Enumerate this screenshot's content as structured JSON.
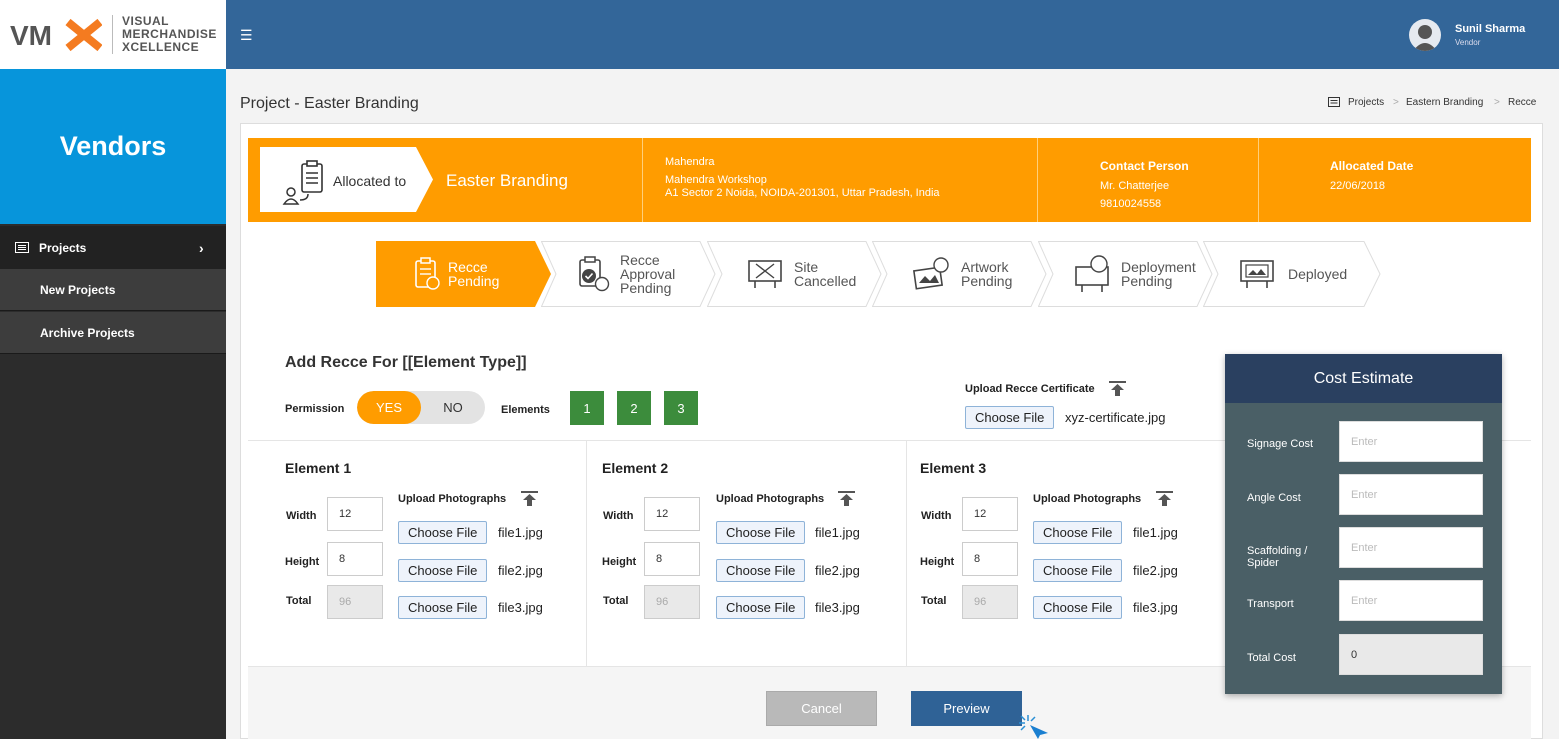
{
  "brand": {
    "logo": "VMX",
    "line1": "VISUAL",
    "line2": "MERCHANDISE",
    "line3": "XCELLENCE"
  },
  "sidebar": {
    "section_title": "Vendors",
    "items": [
      {
        "label": "Projects"
      },
      {
        "label": "New Projects"
      },
      {
        "label": "Archive Projects"
      }
    ]
  },
  "user": {
    "name": "Sunil Sharma",
    "role": "Vendor"
  },
  "page": {
    "title": "Project - Easter Branding"
  },
  "breadcrumb": [
    "Projects",
    "Eastern Branding",
    "Recce"
  ],
  "header": {
    "allocated_label": "Allocated to",
    "project_name": "Easter Branding",
    "vendor_name": "Mahendra",
    "workshop": "Mahendra Workshop",
    "address": "A1 Sector 2 Noida, NOIDA-201301, Uttar Pradesh, India",
    "contact_label": "Contact Person",
    "contact_name": "Mr. Chatterjee",
    "contact_phone": "9810024558",
    "date_label": "Allocated Date",
    "date_value": "22/06/2018"
  },
  "steps": [
    {
      "line1": "Recce",
      "line2": "Pending",
      "line3": "",
      "active": true
    },
    {
      "line1": "Recce",
      "line2": "Approval",
      "line3": "Pending",
      "active": false
    },
    {
      "line1": "Site",
      "line2": "Cancelled",
      "line3": "",
      "active": false
    },
    {
      "line1": "Artwork",
      "line2": "Pending",
      "line3": "",
      "active": false
    },
    {
      "line1": "Deployment",
      "line2": "Pending",
      "line3": "",
      "active": false
    },
    {
      "line1": "Deployed",
      "line2": "",
      "line3": "",
      "active": false
    }
  ],
  "form": {
    "heading": "Add Recce For [[Element Type]]",
    "permission_label": "Permission",
    "yes": "YES",
    "no": "NO",
    "elements_label": "Elements",
    "element_buttons": [
      "1",
      "2",
      "3"
    ],
    "certificate_label": "Upload Recce Certificate",
    "certificate_button": "Choose File",
    "certificate_file": "xyz-certificate.jpg"
  },
  "elements": [
    {
      "title": "Element 1",
      "width_label": "Width",
      "width": "12",
      "height_label": "Height",
      "height": "8",
      "total_label": "Total",
      "total": "96",
      "upload_label": "Upload Photographs",
      "choose": "Choose File",
      "files": [
        "file1.jpg",
        "file2.jpg",
        "file3.jpg"
      ]
    },
    {
      "title": "Element 2",
      "width_label": "Width",
      "width": "12",
      "height_label": "Height",
      "height": "8",
      "total_label": "Total",
      "total": "96",
      "upload_label": "Upload Photographs",
      "choose": "Choose File",
      "files": [
        "file1.jpg",
        "file2.jpg",
        "file3.jpg"
      ]
    },
    {
      "title": "Element 3",
      "width_label": "Width",
      "width": "12",
      "height_label": "Height",
      "height": "8",
      "total_label": "Total",
      "total": "96",
      "upload_label": "Upload Photographs",
      "choose": "Choose File",
      "files": [
        "file1.jpg",
        "file2.jpg",
        "file3.jpg"
      ]
    }
  ],
  "cost": {
    "title": "Cost Estimate",
    "rows": [
      {
        "label": "Signage Cost",
        "placeholder": "Enter"
      },
      {
        "label": "Angle Cost",
        "placeholder": "Enter"
      },
      {
        "label": "Scaffolding / Spider",
        "placeholder": "Enter"
      },
      {
        "label": "Transport",
        "placeholder": "Enter"
      }
    ],
    "total_label": "Total Cost",
    "total_value": "0"
  },
  "actions": {
    "cancel": "Cancel",
    "preview": "Preview"
  },
  "colors": {
    "topbar": "#336699",
    "accent": "#0795db",
    "orange": "#ff9c00",
    "green": "#3c8c3c",
    "cost_head": "#2a4060"
  }
}
